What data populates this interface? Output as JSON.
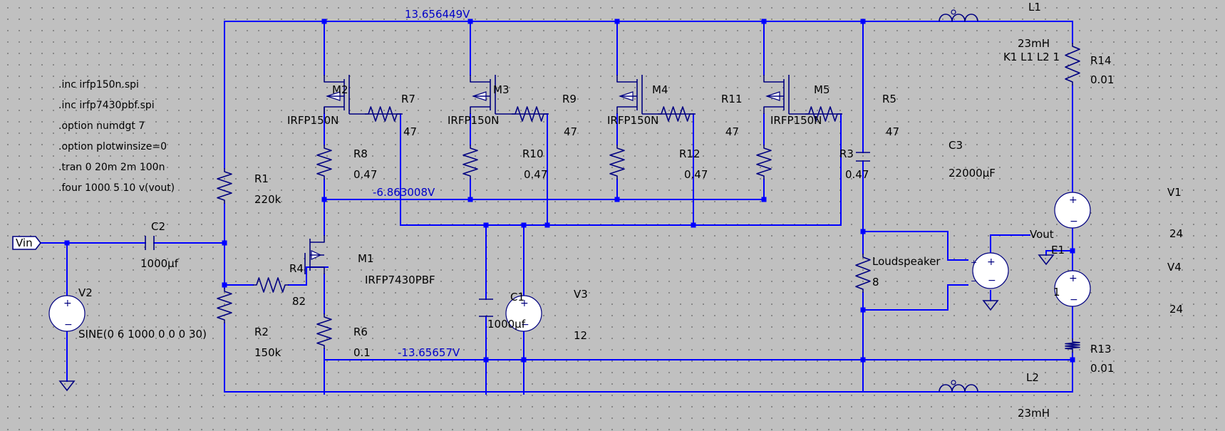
{
  "directives": [
    ".inc irfp150n.spi",
    ".inc irfp7430pbf.spi",
    ".option numdgt 7",
    ".option plotwinsize=0",
    ".tran 0 20m 2m 100n",
    ".four 1000 5 10 v(vout)"
  ],
  "net_labels": {
    "top_rail": "13.656449V",
    "mid_rail": "-6.863008V",
    "bottom_rail": "-13.65657V",
    "vin": "Vin",
    "vout": "Vout"
  },
  "components": {
    "M1": {
      "name": "M1",
      "model": "IRFP7430PBF"
    },
    "M2": {
      "name": "M2",
      "model": "IRFP150N"
    },
    "M3": {
      "name": "M3",
      "model": "IRFP150N"
    },
    "M4": {
      "name": "M4",
      "model": "IRFP150N"
    },
    "M5": {
      "name": "M5",
      "model": "IRFP150N"
    },
    "R1": {
      "name": "R1",
      "value": "220k"
    },
    "R2": {
      "name": "R2",
      "value": "150k"
    },
    "R3": {
      "name": "R3",
      "value": "0.47"
    },
    "R4": {
      "name": "R4",
      "value": "82"
    },
    "R5": {
      "name": "R5",
      "value": "47"
    },
    "R6": {
      "name": "R6",
      "value": "0.1"
    },
    "R7": {
      "name": "R7",
      "value": "47"
    },
    "R8": {
      "name": "R8",
      "value": "0.47"
    },
    "R9": {
      "name": "R9",
      "value": "47"
    },
    "R10": {
      "name": "R10",
      "value": "0.47"
    },
    "R11": {
      "name": "R11",
      "value": "47"
    },
    "R12": {
      "name": "R12",
      "value": "0.47"
    },
    "R13": {
      "name": "R13",
      "value": "0.01"
    },
    "R14": {
      "name": "R14",
      "value": "0.01"
    },
    "Loudspeaker": {
      "name": "Loudspeaker",
      "value": "8"
    },
    "C1": {
      "name": "C1",
      "value": "1000µf"
    },
    "C2": {
      "name": "C2",
      "value": "1000µf"
    },
    "C3": {
      "name": "C3",
      "value": "22000µF"
    },
    "L1": {
      "name": "L1",
      "value": "23mH",
      "extra": "K1 L1 L2 1"
    },
    "L2": {
      "name": "L2",
      "value": "23mH"
    },
    "V1": {
      "name": "V1",
      "value": "24"
    },
    "V2": {
      "name": "V2",
      "value": "SINE(0 6 1000 0 0 0 30)"
    },
    "V3": {
      "name": "V3",
      "value": "12"
    },
    "V4": {
      "name": "V4",
      "value": "24"
    },
    "E1": {
      "name": "E1",
      "value": "1"
    }
  }
}
